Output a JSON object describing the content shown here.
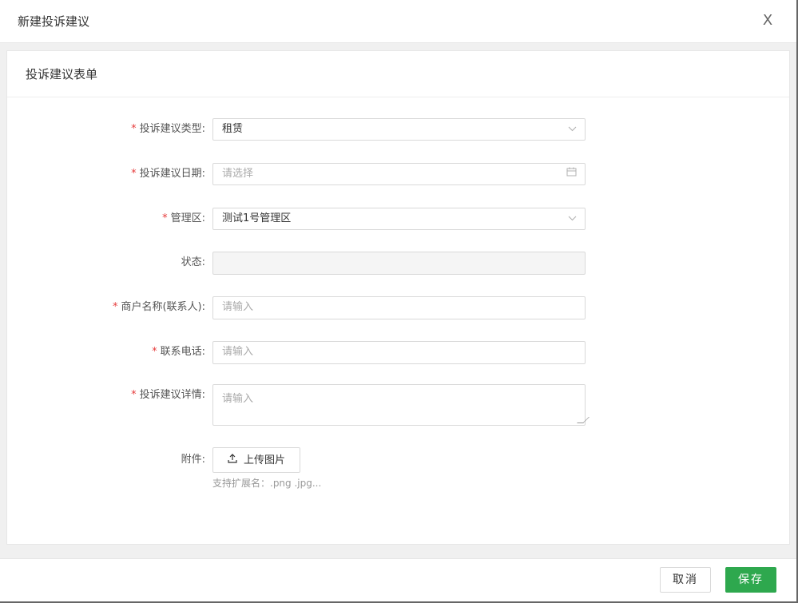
{
  "dialog": {
    "title": "新建投诉建议",
    "close_label": "X"
  },
  "form": {
    "section_title": "投诉建议表单",
    "fields": [
      {
        "label": "投诉建议类型:",
        "required": true,
        "value": "租赁",
        "placeholder": "",
        "type": "select",
        "icon": "chevron-down-icon"
      },
      {
        "label": "投诉建议日期:",
        "required": true,
        "value": "",
        "placeholder": "请选择",
        "type": "date",
        "icon": "calendar-icon"
      },
      {
        "label": "管理区:",
        "required": true,
        "value": "测试1号管理区",
        "placeholder": "",
        "type": "select",
        "icon": "chevron-down-icon"
      },
      {
        "label": "状态:",
        "required": false,
        "value": "",
        "placeholder": "",
        "type": "disabled"
      },
      {
        "label": "商户名称(联系人):",
        "required": true,
        "value": "",
        "placeholder": "请输入",
        "type": "input"
      },
      {
        "label": "联系电话:",
        "required": true,
        "value": "",
        "placeholder": "请输入",
        "type": "input"
      },
      {
        "label": "投诉建议详情:",
        "required": true,
        "value": "",
        "placeholder": "请输入",
        "type": "textarea"
      }
    ],
    "attachment": {
      "label": "附件:",
      "button_label": "上传图片",
      "hint": "支持扩展名：.png .jpg..."
    },
    "required_mark": "*"
  },
  "footer": {
    "cancel_label": "取消",
    "save_label": "保存"
  },
  "colors": {
    "save": "#2ea84e",
    "required": "#e63b3b"
  }
}
